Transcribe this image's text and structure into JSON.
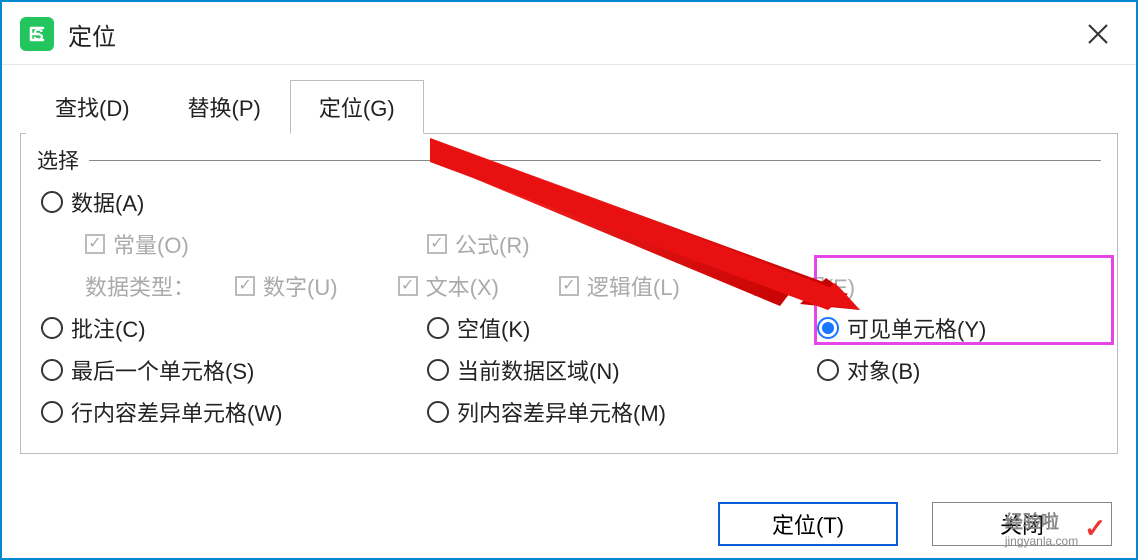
{
  "window": {
    "title": "定位"
  },
  "tabs": {
    "find": "查找(D)",
    "replace": "替换(P)",
    "goto": "定位(G)"
  },
  "section": {
    "label": "选择"
  },
  "options": {
    "data": "数据(A)",
    "constant": "常量(O)",
    "formula": "公式(R)",
    "datatype_label": "数据类型：",
    "number": "数字(U)",
    "text": "文本(X)",
    "logic": "逻辑值(L)",
    "error": "错误(E)",
    "comment": "批注(C)",
    "blank": "空值(K)",
    "visible": "可见单元格(Y)",
    "lastcell": "最后一个单元格(S)",
    "currentregion": "当前数据区域(N)",
    "object": "对象(B)",
    "rowdiff": "行内容差异单元格(W)",
    "coldiff": "列内容差异单元格(M)"
  },
  "buttons": {
    "goto": "定位(T)",
    "close": "关闭"
  },
  "watermark": {
    "main": "经验啦",
    "sub": "jingyanla.com"
  }
}
